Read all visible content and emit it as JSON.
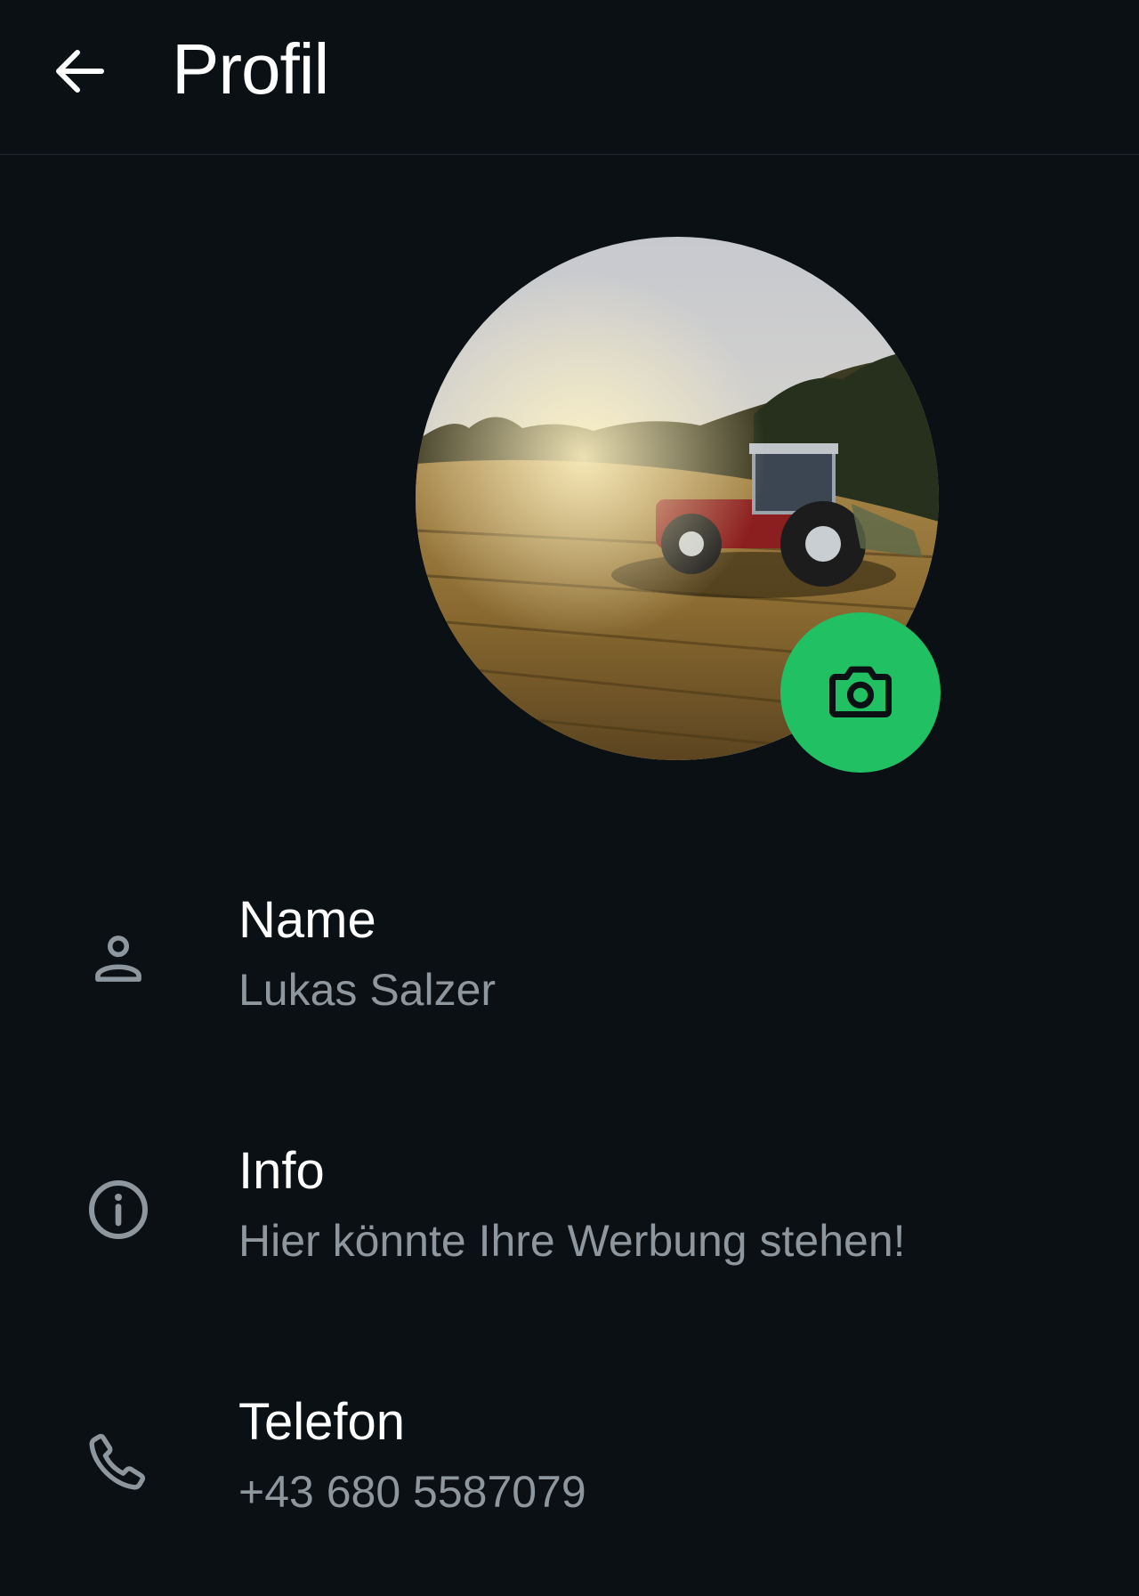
{
  "header": {
    "title": "Profil",
    "back_icon": "arrow-left-icon"
  },
  "profile_photo": {
    "subject": "red tractor in a sunlit field",
    "edit_icon": "camera-icon",
    "accent_color": "#21c063"
  },
  "rows": [
    {
      "icon": "person-icon",
      "label": "Name",
      "value": "Lukas Salzer"
    },
    {
      "icon": "info-icon",
      "label": "Info",
      "value": "Hier könnte Ihre Werbung stehen!"
    },
    {
      "icon": "phone-icon",
      "label": "Telefon",
      "value": "+43 680 5587079"
    }
  ],
  "colors": {
    "background": "#0b1014",
    "primary_text": "#ffffff",
    "secondary_text": "#8d979d",
    "icon": "#8d979d",
    "accent": "#21c063"
  }
}
